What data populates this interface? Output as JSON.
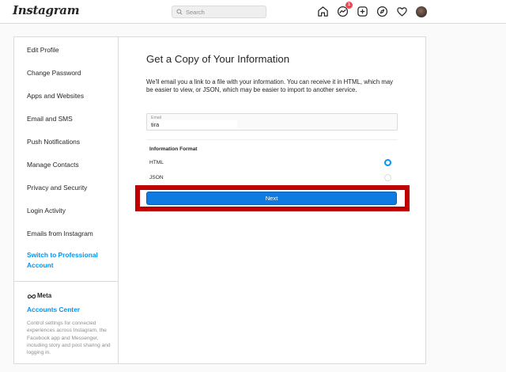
{
  "header": {
    "logo": "Instagram",
    "search_placeholder": "Search",
    "notification_count": "1",
    "icons": [
      "home-icon",
      "messenger-icon",
      "new-post-icon",
      "explore-icon",
      "heart-icon",
      "avatar"
    ]
  },
  "sidebar": {
    "items": [
      "Edit Profile",
      "Change Password",
      "Apps and Websites",
      "Email and SMS",
      "Push Notifications",
      "Manage Contacts",
      "Privacy and Security",
      "Login Activity",
      "Emails from Instagram"
    ],
    "professional_line1": "Switch to Professional",
    "professional_line2": "Account",
    "meta_logo": "Meta",
    "accounts_center": "Accounts Center",
    "accounts_center_desc": "Control settings for connected experiences across Instagram, the Facebook app and Messenger, including story and post sharing and logging in."
  },
  "main": {
    "title": "Get a Copy of Your Information",
    "description": "We'll email you a link to a file with your information. You can receive it in HTML, which may be easier to view, or JSON, which may be easier to import to another service.",
    "email_label": "Email",
    "email_value": "tira",
    "format_title": "Information Format",
    "options": [
      {
        "label": "HTML",
        "selected": true
      },
      {
        "label": "JSON",
        "selected": false
      }
    ],
    "next_label": "Next"
  },
  "colors": {
    "accent": "#0095f6",
    "button": "#0f7ae0",
    "highlight": "#c00000",
    "badge": "#ed4956"
  }
}
